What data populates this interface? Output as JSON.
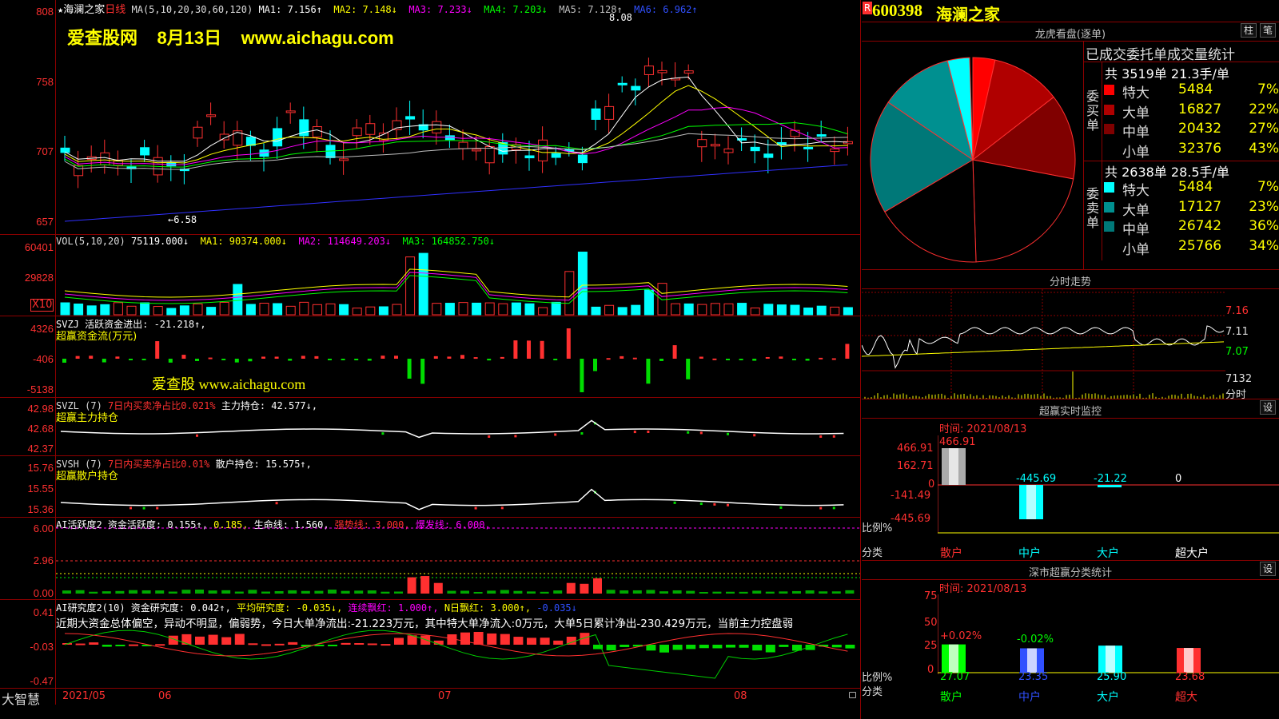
{
  "main_chart": {
    "star": "★",
    "stock_name": "海澜之家",
    "period": "日线",
    "ma_params": "MA(5,10,20,30,60,120)",
    "ma1": "MA1: 7.156↑",
    "ma2": "MA2: 7.148↓",
    "ma3": "MA3: 7.233↓",
    "ma4": "MA4: 7.203↓",
    "ma5": "MA5: 7.128↑",
    "ma6": "MA6: 6.962↑",
    "high_label": "8.08",
    "low_label": "←6.58",
    "watermark": "爱查股网    8月13日    www.aichagu.com",
    "y_ticks": [
      "808",
      "758",
      "707",
      "657"
    ]
  },
  "vol_panel": {
    "header_prefix": "VOL(5,10,20)",
    "vol": "75119.000↓",
    "ma1": "MA1: 90374.000↓",
    "ma2": "MA2: 114649.203↓",
    "ma3": "MA3: 164852.750↓",
    "y_ticks": [
      "60401",
      "29828"
    ],
    "unit": "X10"
  },
  "svzj_panel": {
    "header": "SVZJ  活跃资金进出: -21.218↑,",
    "subtitle": "超赢资金流(万元)",
    "watermark": "爱查股 www.aichagu.com",
    "y_ticks": [
      "4326",
      "-406",
      "-5138"
    ]
  },
  "svzl_panel": {
    "header_a": "SVZL (7)",
    "header_b": "7日内买卖净占比0.021%",
    "header_c": "主力持仓: 42.577↓,",
    "subtitle": "超赢主力持仓",
    "y_ticks": [
      "42.98",
      "42.68",
      "42.37"
    ]
  },
  "svsh_panel": {
    "header_a": "SVSH (7)",
    "header_b": "7日内买卖净占比0.01%",
    "header_c": "散户持仓: 15.575↑,",
    "subtitle": "超赢散户持仓",
    "y_ticks": [
      "15.76",
      "15.55",
      "15.36"
    ]
  },
  "ai_active_panel": {
    "header_a": "AI活跃度2 资金活跃度: 0.155↑,",
    "header_b": "0.185,",
    "header_c": "生命线: 1.560,",
    "header_d": "强势线: 3.000,",
    "header_e": "爆发线: 6.000,",
    "y_ticks": [
      "6.00",
      "2.96",
      "0.00"
    ]
  },
  "ai_research_panel": {
    "header_a": "AI研究度2(10) 资金研究度: 0.042↑,",
    "header_b": "平均研究度: -0.035↓,",
    "header_c": "连续飘红: 1.000↑,",
    "header_d": "N日飘红: 3.000↑,",
    "header_e": "-0.035↓",
    "analysis_text": "近期大资金总体偏空，异动不明显，偏弱势，今日大单净流出:-21.223万元，其中特大单净流入:0万元，大单5日累计净出-230.429万元，当前主力控盘弱",
    "y_ticks": [
      "0.41",
      "-0.03",
      "-0.47"
    ]
  },
  "bottom_axis": {
    "brand": "大智慧",
    "labels": [
      "2021/05",
      "06",
      "07",
      "08"
    ]
  },
  "side_header": {
    "r_badge": "R",
    "code": "600398",
    "name": "海澜之家"
  },
  "dragon_panel": {
    "title": "龙虎看盘(逐单)",
    "btn_bar": "柱",
    "btn_pen": "笔",
    "stats_title": "已成交委托单成交量统计",
    "buy_summary": "共 3519单 21.3手/单",
    "buy_label": "委买单",
    "sell_summary": "共 2638单 28.5手/单",
    "sell_label": "委卖单",
    "buy_rows": [
      {
        "name": "特大",
        "vol": "5484",
        "pct": "7%",
        "color": "#ff0000"
      },
      {
        "name": "大单",
        "vol": "16827",
        "pct": "22%",
        "color": "#b00000"
      },
      {
        "name": "中单",
        "vol": "20432",
        "pct": "27%",
        "color": "#800000"
      },
      {
        "name": "小单",
        "vol": "32376",
        "pct": "43%",
        "color": "#000000"
      }
    ],
    "sell_rows": [
      {
        "name": "特大",
        "vol": "5484",
        "pct": "7%",
        "color": "#00ffff"
      },
      {
        "name": "大单",
        "vol": "17127",
        "pct": "23%",
        "color": "#009090"
      },
      {
        "name": "中单",
        "vol": "26742",
        "pct": "36%",
        "color": "#007878"
      },
      {
        "name": "小单",
        "vol": "25766",
        "pct": "34%",
        "color": "#000000"
      }
    ]
  },
  "intraday_panel": {
    "title": "分时走势",
    "y_ticks": [
      "7.16",
      "7.11",
      "7.07"
    ],
    "vol_tick": "7132",
    "vol_unit": "分时"
  },
  "monitor_panel": {
    "title": "超赢实时监控",
    "btn": "设",
    "time": "时间: 2021/08/13",
    "y_ticks": [
      "466.91",
      "162.71",
      "0",
      "-141.49",
      "-445.69"
    ],
    "bar_values": [
      "466.91",
      "-445.69",
      "-21.22",
      "0"
    ],
    "ratio_label": "比例%",
    "cat_label": "分类",
    "cats": [
      "散户",
      "中户",
      "大户",
      "超大户"
    ]
  },
  "shenzhen_panel": {
    "title": "深市超赢分类统计",
    "btn": "设",
    "time": "时间: 2021/08/13",
    "y_ticks": [
      "75",
      "50",
      "25",
      "0"
    ],
    "top_labels": [
      "+0.02%",
      "-0.02%"
    ],
    "values": [
      "27.07",
      "23.35",
      "25.90",
      "23.68"
    ],
    "ratio_label": "比例%",
    "cat_label": "分类",
    "cats": [
      "散户",
      "中户",
      "大户",
      "超大"
    ]
  },
  "colors": {
    "up": "#ff3030",
    "down": "#00ffff",
    "grid": "#8b0000",
    "ma1": "#ffffff",
    "ma2": "#ffff00",
    "ma3": "#ff00ff",
    "ma4": "#00ff00",
    "ma5": "#c0c0c0",
    "ma6": "#3030ff"
  }
}
